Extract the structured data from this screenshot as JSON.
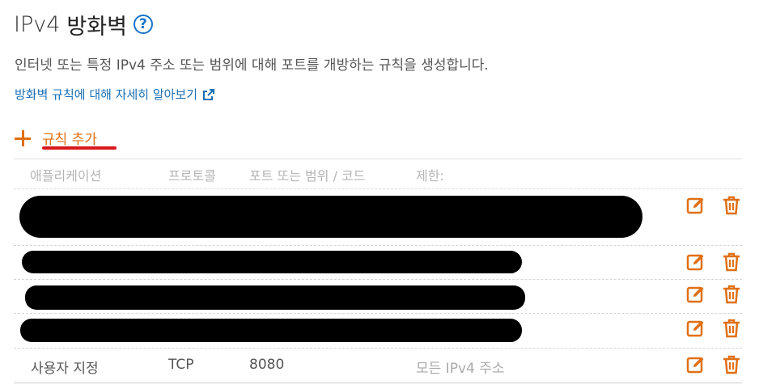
{
  "header": {
    "title_prefix": "IPv4",
    "title_main": "방화벽",
    "help_glyph": "?"
  },
  "description": "인터넷 또는 특정 IPv4 주소 또는 범위에 대해 포트를 개방하는 규칙을 생성합니다.",
  "learn_more_link": "방화벽 규칙에 대해 자세히 알아보기",
  "add_rule_label": "규칙 추가",
  "table": {
    "columns": [
      "애플리케이션",
      "프로토콜",
      "포트 또는 범위 / 코드",
      "제한:"
    ],
    "rows": [
      {
        "application": "",
        "protocol": "",
        "port": "",
        "restriction": "",
        "redacted": true
      },
      {
        "application": "",
        "protocol": "",
        "port": "",
        "restriction": "",
        "redacted": true
      },
      {
        "application": "",
        "protocol": "",
        "port": "",
        "restriction": "",
        "redacted": true
      },
      {
        "application": "",
        "protocol": "",
        "port": "",
        "restriction": "",
        "redacted": true
      },
      {
        "application": "사용자 지정",
        "protocol": "TCP",
        "port": "8080",
        "restriction": "모든 IPv4 주소",
        "redacted": false
      }
    ]
  },
  "colors": {
    "accent": "#e07015",
    "link": "#1a6fb5",
    "underline_mark": "#d9171c"
  },
  "icons": [
    "help-icon",
    "external-link-icon",
    "plus-icon",
    "edit-icon",
    "trash-icon"
  ]
}
